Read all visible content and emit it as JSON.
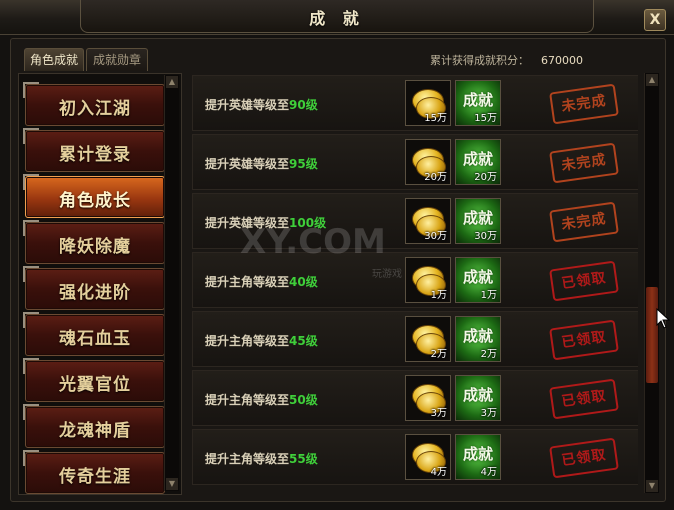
{
  "window": {
    "title": "成 就",
    "close_label": "X"
  },
  "tabs": [
    {
      "label": "角色成就",
      "active": true
    },
    {
      "label": "成就勋章",
      "active": false
    }
  ],
  "score": {
    "label": "累计获得成就积分：",
    "value": "670000"
  },
  "menu": [
    {
      "label": "初入江湖",
      "active": false
    },
    {
      "label": "累计登录",
      "active": false
    },
    {
      "label": "角色成长",
      "active": true
    },
    {
      "label": "降妖除魔",
      "active": false
    },
    {
      "label": "强化进阶",
      "active": false
    },
    {
      "label": "魂石血玉",
      "active": false
    },
    {
      "label": "光翼官位",
      "active": false
    },
    {
      "label": "龙魂神盾",
      "active": false
    },
    {
      "label": "传奇生涯",
      "active": false
    }
  ],
  "achievements": [
    {
      "prefix": "提升英雄等级至",
      "level": "90级",
      "coin": "15万",
      "badge": "成就",
      "points": "15万",
      "status": "未完成"
    },
    {
      "prefix": "提升英雄等级至",
      "level": "95级",
      "coin": "20万",
      "badge": "成就",
      "points": "20万",
      "status": "未完成"
    },
    {
      "prefix": "提升英雄等级至",
      "level": "100级",
      "coin": "30万",
      "badge": "成就",
      "points": "30万",
      "status": "未完成"
    },
    {
      "prefix": "提升主角等级至",
      "level": "40级",
      "coin": "1万",
      "badge": "成就",
      "points": "1万",
      "status": "已领取"
    },
    {
      "prefix": "提升主角等级至",
      "level": "45级",
      "coin": "2万",
      "badge": "成就",
      "points": "2万",
      "status": "已领取"
    },
    {
      "prefix": "提升主角等级至",
      "level": "50级",
      "coin": "3万",
      "badge": "成就",
      "points": "3万",
      "status": "已领取"
    },
    {
      "prefix": "提升主角等级至",
      "level": "55级",
      "coin": "4万",
      "badge": "成就",
      "points": "4万",
      "status": "已领取"
    }
  ],
  "watermark": {
    "text": "XY.COM",
    "sub": "玩游戏"
  },
  "colors": {
    "level_text": "#3fcf3a",
    "stamp_pending": "#c2481f",
    "stamp_done": "#c11a1a",
    "menu_active": "#d9691e"
  }
}
